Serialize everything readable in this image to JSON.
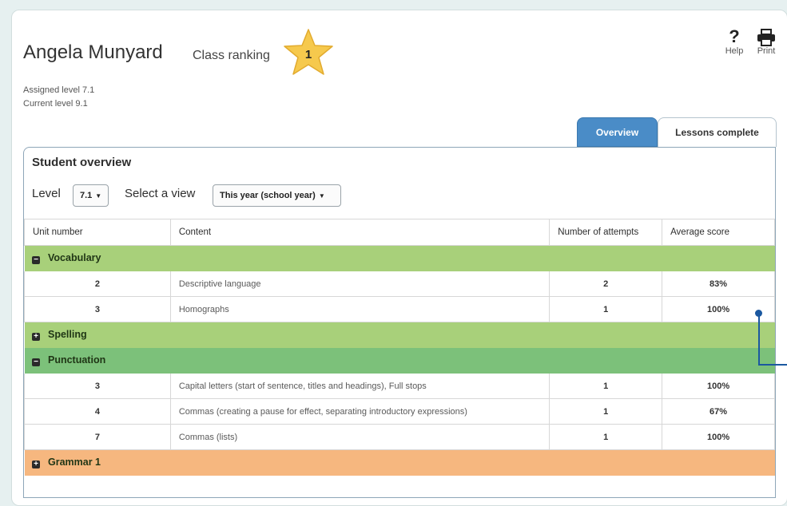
{
  "student": {
    "name": "Angela Munyard",
    "ranking_label": "Class ranking",
    "ranking_value": "1",
    "assigned_level": "Assigned level 7.1",
    "current_level": "Current level 9.1"
  },
  "tools": {
    "help_label": "Help",
    "print_label": "Print",
    "help_icon": "question-mark-icon",
    "print_icon": "printer-icon"
  },
  "tabs": {
    "overview": "Overview",
    "lessons": "Lessons complete"
  },
  "panel": {
    "title": "Student overview",
    "level_label": "Level",
    "level_value": "7.1",
    "view_label": "Select a view",
    "view_value": "This year (school year)"
  },
  "table": {
    "headers": [
      "Unit number",
      "Content",
      "Number of attempts",
      "Average score"
    ],
    "categories": {
      "vocabulary": {
        "name": "Vocabulary",
        "expanded": true,
        "color": "#a8d07a"
      },
      "spelling": {
        "name": "Spelling",
        "expanded": false,
        "color": "#a8d07a"
      },
      "punctuation": {
        "name": "Punctuation",
        "expanded": true,
        "color": "#7cc17a"
      },
      "grammar": {
        "name": "Grammar 1",
        "expanded": false,
        "color": "#f6b77f"
      }
    },
    "vocabulary_rows": [
      {
        "unit": "2",
        "content": "Descriptive language",
        "attempts": "2",
        "score": "83%"
      },
      {
        "unit": "3",
        "content": "Homographs",
        "attempts": "1",
        "score": "100%"
      }
    ],
    "punctuation_rows": [
      {
        "unit": "3",
        "content": "Capital letters (start of sentence, titles and headings), Full stops",
        "attempts": "1",
        "score": "100%"
      },
      {
        "unit": "4",
        "content": "Commas (creating a pause for effect, separating introductory expressions)",
        "attempts": "1",
        "score": "67%"
      },
      {
        "unit": "7",
        "content": "Commas (lists)",
        "attempts": "1",
        "score": "100%"
      }
    ]
  },
  "colors": {
    "accent": "#4a8cc7",
    "star": "#f6c94d",
    "callout": "#1b58a0"
  }
}
